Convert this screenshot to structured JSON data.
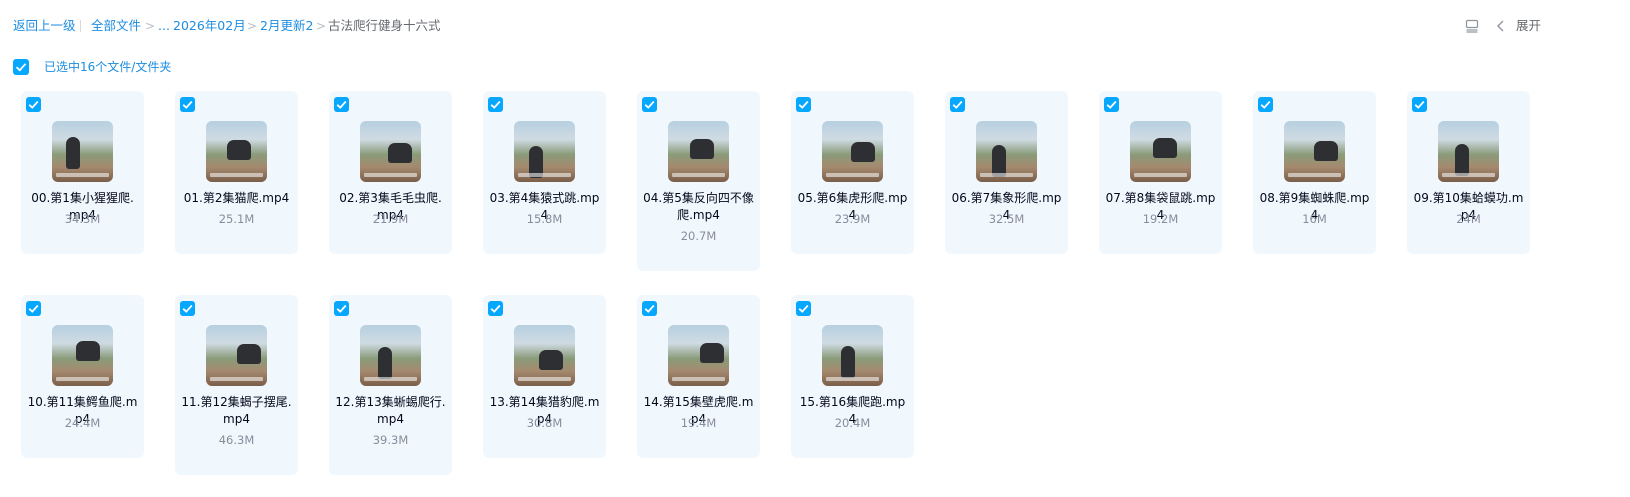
{
  "breadcrumb": {
    "back": "返回上一级",
    "root": "全部文件",
    "ellipsis": "...",
    "folder1": "2026年02月",
    "folder2": "2月更新2",
    "current": "古法爬行健身十六式"
  },
  "toolbar": {
    "view_icon": "list-view-icon",
    "expand_label": "展开"
  },
  "selection": {
    "label": "已选中16个文件/文件夹",
    "checked": true
  },
  "colors": {
    "accent": "#06a7ff",
    "link": "#1c8de0",
    "card_bg": "#f1f8fd"
  },
  "files": [
    {
      "name": "00.第1集小猩猩爬.mp4",
      "size": "34.3M"
    },
    {
      "name": "01.第2集猫爬.mp4",
      "size": "25.1M"
    },
    {
      "name": "02.第3集毛毛虫爬.mp4",
      "size": "21.9M"
    },
    {
      "name": "03.第4集猿式跳.mp4",
      "size": "15.8M"
    },
    {
      "name": "04.第5集反向四不像爬.mp4",
      "size": "20.7M"
    },
    {
      "name": "05.第6集虎形爬.mp4",
      "size": "23.9M"
    },
    {
      "name": "06.第7集象形爬.mp4",
      "size": "32.5M"
    },
    {
      "name": "07.第8集袋鼠跳.mp4",
      "size": "19.2M"
    },
    {
      "name": "08.第9集蜘蛛爬.mp4",
      "size": "16M"
    },
    {
      "name": "09.第10集蛤蟆功.mp4",
      "size": "24M"
    },
    {
      "name": "10.第11集鳄鱼爬.mp4",
      "size": "24.4M"
    },
    {
      "name": "11.第12集蝎子摆尾.mp4",
      "size": "46.3M"
    },
    {
      "name": "12.第13集蜥蜴爬行.mp4",
      "size": "39.3M"
    },
    {
      "name": "13.第14集猎豹爬.mp4",
      "size": "30.8M"
    },
    {
      "name": "14.第15集壁虎爬.mp4",
      "size": "19.4M"
    },
    {
      "name": "15.第16集爬跑.mp4",
      "size": "20.4M"
    }
  ]
}
